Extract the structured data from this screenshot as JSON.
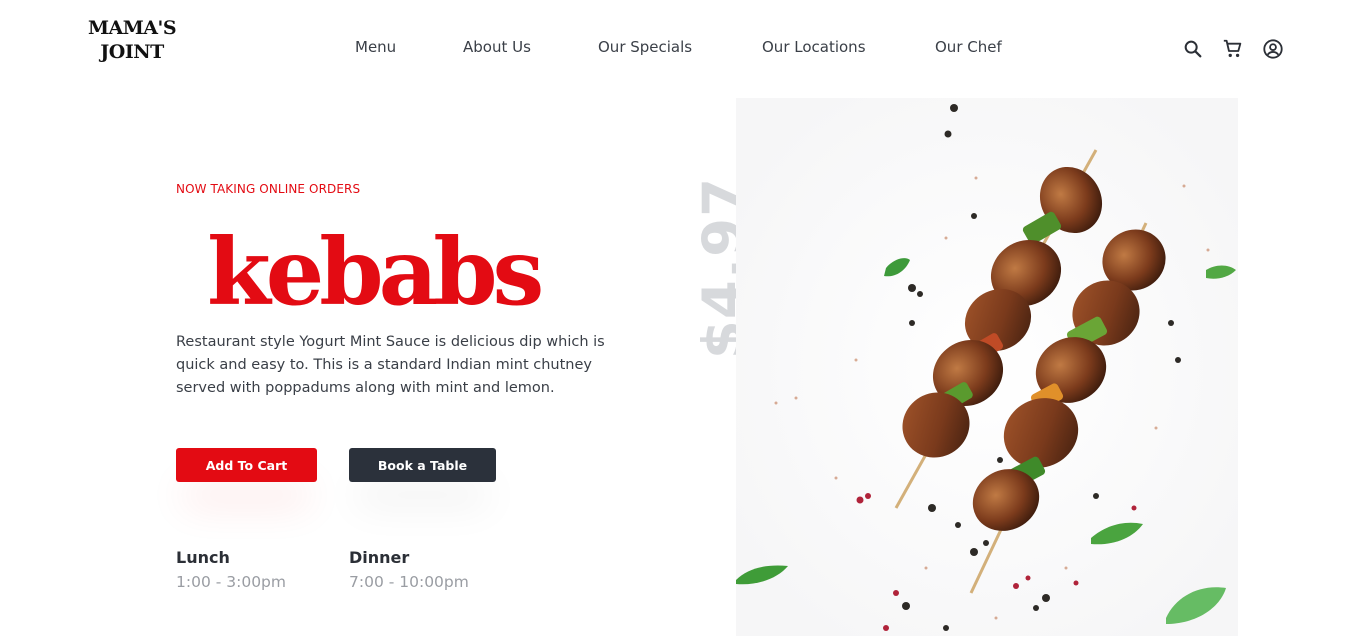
{
  "brand": {
    "line1": "MAMA'S",
    "line2": "JOINT"
  },
  "nav": [
    {
      "label": "Menu"
    },
    {
      "label": "About Us"
    },
    {
      "label": "Our Specials"
    },
    {
      "label": "Our Locations"
    },
    {
      "label": "Our Chef"
    }
  ],
  "header_icons": [
    "search-icon",
    "cart-icon",
    "account-icon"
  ],
  "hero": {
    "eyebrow": "NOW TAKING ONLINE ORDERS",
    "title": "kebabs",
    "description": "Restaurant style Yogurt Mint Sauce is delicious dip which is quick and easy to. This is a standard Indian mint chutney served with poppadums along with mint and lemon.",
    "add_to_cart": "Add To Cart",
    "book_table": "Book a Table",
    "price": "$4.97"
  },
  "hours": {
    "lunch_label": "Lunch",
    "lunch_time": "1:00 - 3:00pm",
    "dinner_label": "Dinner",
    "dinner_time": "7:00 - 10:00pm"
  },
  "colors": {
    "accent": "#e30b13",
    "dark": "#2b313b",
    "muted": "#9a9da3",
    "price": "#d7d9dc"
  }
}
